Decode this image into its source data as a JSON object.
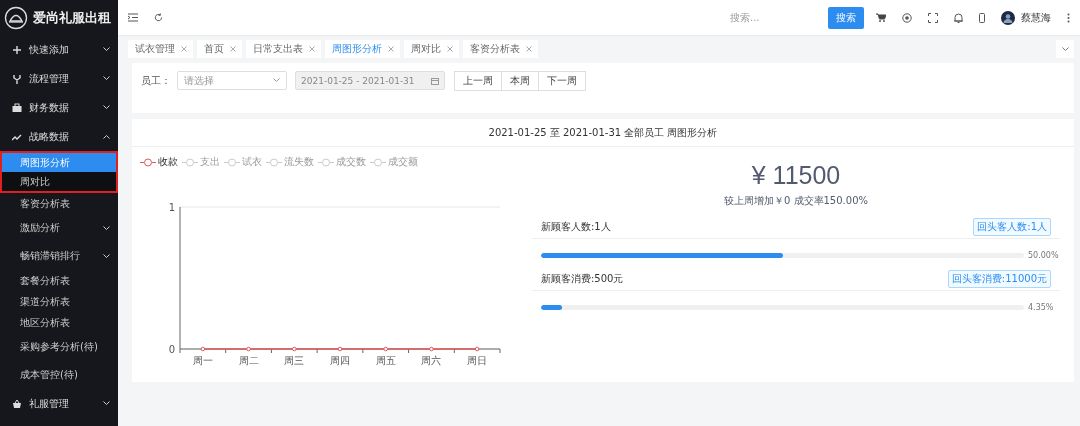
{
  "sidebar": {
    "logo": "爱尚礼服出租",
    "items": [
      {
        "label": "快速添加",
        "expanded": false
      },
      {
        "label": "流程管理",
        "expanded": false
      },
      {
        "label": "财务数据",
        "expanded": false
      },
      {
        "label": "战略数据",
        "expanded": true,
        "children": [
          {
            "label": "周图形分析",
            "selected": true,
            "highlighted": true,
            "kind": "link"
          },
          {
            "label": "周对比",
            "selected": false,
            "highlighted": true,
            "kind": "link"
          },
          {
            "label": "客资分析表",
            "selected": false,
            "highlighted": false,
            "kind": "link"
          },
          {
            "label": "激励分析",
            "selected": false,
            "highlighted": false,
            "kind": "submenu",
            "expanded": false
          },
          {
            "label": "畅销滞销排行",
            "selected": false,
            "highlighted": false,
            "kind": "submenu",
            "expanded": false
          },
          {
            "label": "套餐分析表",
            "selected": false,
            "highlighted": false,
            "kind": "link"
          },
          {
            "label": "渠道分析表",
            "selected": false,
            "highlighted": false,
            "kind": "link"
          },
          {
            "label": "地区分析表",
            "selected": false,
            "highlighted": false,
            "kind": "link"
          },
          {
            "label": "采购参考分析(待)",
            "selected": false,
            "highlighted": false,
            "kind": "link"
          },
          {
            "label": "成本管控(待)",
            "selected": false,
            "highlighted": false,
            "kind": "link"
          }
        ]
      },
      {
        "label": "礼服管理",
        "expanded": false
      }
    ]
  },
  "topbar": {
    "search": {
      "placeholder": "搜索..."
    },
    "search_button": "搜索",
    "user": "蔡慧海"
  },
  "tabs": [
    {
      "label": "试衣管理",
      "selected": false
    },
    {
      "label": "首页",
      "selected": false
    },
    {
      "label": "日常支出表",
      "selected": false
    },
    {
      "label": "周图形分析",
      "selected": true
    },
    {
      "label": "周对比",
      "selected": false
    },
    {
      "label": "客资分析表",
      "selected": false
    }
  ],
  "filter": {
    "label": "员工：",
    "select": {
      "placeholder": "请选择"
    },
    "date_range": {
      "value": "2021-01-25 - 2021-01-31",
      "disabled": true
    },
    "buttons": [
      "上一周",
      "本周",
      "下一周"
    ]
  },
  "report": {
    "title": "2021-01-25 至 2021-01-31 全部员工 周图形分析",
    "chart_data": {
      "type": "line",
      "categories": [
        "周一",
        "周二",
        "周三",
        "周四",
        "周五",
        "周六",
        "周日"
      ],
      "series": [
        {
          "name": "收款",
          "color": "#e05a5a",
          "marker": "circle",
          "values": [
            0,
            0,
            0,
            0,
            0,
            0,
            0
          ]
        },
        {
          "name": "支出",
          "marker": "circle",
          "values": [
            null,
            null,
            null,
            null,
            null,
            null,
            null
          ]
        },
        {
          "name": "试衣",
          "marker": "circle",
          "values": [
            null,
            null,
            null,
            null,
            null,
            null,
            null
          ]
        },
        {
          "name": "流失数",
          "marker": "circle",
          "values": [
            null,
            null,
            null,
            null,
            null,
            null,
            null
          ]
        },
        {
          "name": "成交数",
          "marker": "circle",
          "values": [
            null,
            null,
            null,
            null,
            null,
            null,
            null
          ]
        },
        {
          "name": "成交额",
          "marker": "circle",
          "values": [
            null,
            null,
            null,
            null,
            null,
            null,
            null
          ]
        }
      ],
      "ylim": [
        0,
        1
      ],
      "yticks": [
        0,
        1
      ]
    },
    "legend": [
      {
        "selected": true
      },
      {
        "selected": false
      },
      {
        "selected": false
      },
      {
        "selected": false
      },
      {
        "selected": false
      },
      {
        "selected": false
      }
    ],
    "total": "¥ 11500",
    "comparison": "较上周增加￥0 成交率150.00%",
    "stats": [
      {
        "label": "新顾客人数:1人",
        "tag": "回头客人数:1人",
        "level": 0.5,
        "reading": "50.00%"
      },
      {
        "label": "新顾客消费:500元",
        "tag": "回头客消费:11000元",
        "level": 0.0435,
        "reading": "4.35%"
      }
    ]
  }
}
